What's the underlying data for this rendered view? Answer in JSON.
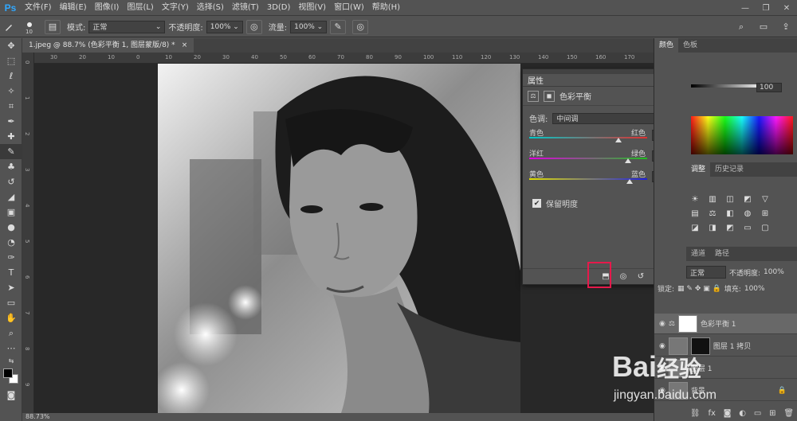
{
  "menubar": {
    "logo": "Ps",
    "items": [
      "文件(F)",
      "编辑(E)",
      "图像(I)",
      "图层(L)",
      "文字(Y)",
      "选择(S)",
      "滤镜(T)",
      "3D(D)",
      "视图(V)",
      "窗口(W)",
      "帮助(H)"
    ],
    "window_controls": [
      "—",
      "❐",
      "✕"
    ]
  },
  "options": {
    "brush_size": "10",
    "mode_label": "模式:",
    "mode_value": "正常",
    "opacity_label": "不透明度:",
    "opacity_value": "100%",
    "flow_label": "流量:",
    "flow_value": "100%"
  },
  "document": {
    "tab_title": "1.jpeg @ 88.7% (色彩平衡 1, 图层蒙版/8) *",
    "tab_close": "×",
    "ruler_h": [
      "30",
      "20",
      "10",
      "0",
      "10",
      "20",
      "30",
      "40",
      "50",
      "60",
      "70",
      "80",
      "90",
      "100",
      "110",
      "120",
      "130",
      "140",
      "150",
      "160",
      "170"
    ],
    "ruler_v": [
      "0",
      "1",
      "2",
      "3",
      "4",
      "5",
      "6",
      "7",
      "8",
      "9"
    ],
    "zoom": "88.73%"
  },
  "properties": {
    "title": "属性",
    "subtitle": "色彩平衡",
    "tone_label": "色调:",
    "tone_value": "中间调",
    "sliders": [
      {
        "left": "青色",
        "right": "红色",
        "value": "+55",
        "fraction": 0.76,
        "gradient": [
          "#00c8c8",
          "#e03030"
        ]
      },
      {
        "left": "洋红",
        "right": "绿色",
        "value": "+72",
        "fraction": 0.84,
        "gradient": [
          "#e000e0",
          "#20c020"
        ]
      },
      {
        "left": "黄色",
        "right": "蓝色",
        "value": "+73",
        "fraction": 0.85,
        "gradient": [
          "#e0e000",
          "#2020e0"
        ]
      }
    ],
    "preserve_label": "保留明度",
    "preserve_checked": "✔"
  },
  "right_panels": {
    "color_tabs": [
      "颜色",
      "色板"
    ],
    "color_value": "100",
    "adjust_tabs": [
      "调整",
      "历史记录"
    ],
    "layers_tabs": [
      "通道",
      "路径"
    ],
    "blend_mode": "正常",
    "opacity_label": "不透明度:",
    "opacity_value": "100%",
    "lock_label": "锁定:",
    "fill_label": "填充:",
    "fill_value": "100%",
    "layers": [
      {
        "name": "色彩平衡 1"
      },
      {
        "name": "图层 1 拷贝"
      },
      {
        "name": "图层 1"
      },
      {
        "name": "背景"
      }
    ]
  },
  "watermark": {
    "brand": "Bai",
    "brand2": "经验",
    "url": "jingyan.baidu.com"
  }
}
